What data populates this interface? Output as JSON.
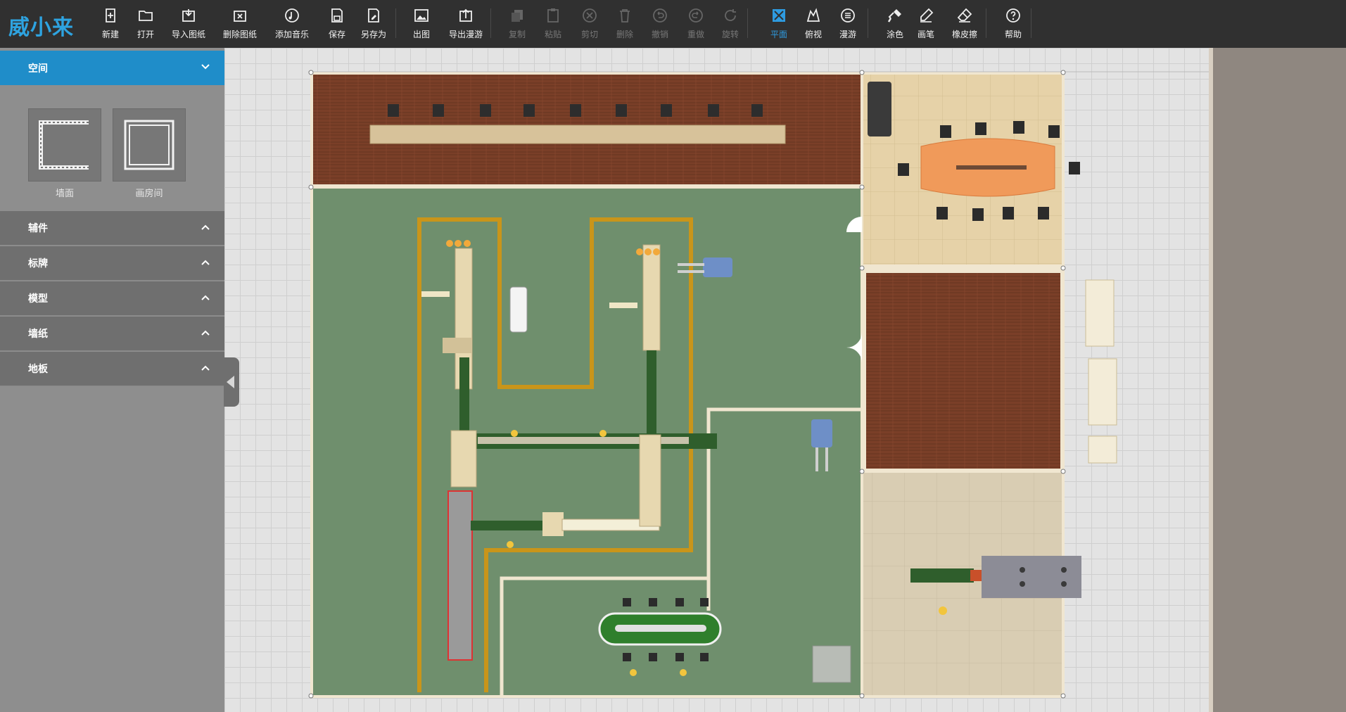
{
  "app": {
    "logo": "威小来"
  },
  "toolbar": {
    "new": "新建",
    "open": "打开",
    "import_drawing": "导入图纸",
    "delete_drawing": "删除图纸",
    "add_music": "添加音乐",
    "save": "保存",
    "save_as": "另存为",
    "render": "出图",
    "export_tour": "导出漫游",
    "copy": "复制",
    "paste": "粘贴",
    "cut": "剪切",
    "delete": "删除",
    "undo": "撤销",
    "redo": "重做",
    "rotate": "旋转",
    "plan_view": "平面",
    "top_view": "俯视",
    "roam": "漫游",
    "paint": "涂色",
    "brush": "画笔",
    "eraser": "橡皮擦",
    "help": "帮助"
  },
  "sidebar": {
    "space": {
      "title": "空间",
      "tiles": [
        {
          "label": "墙面",
          "icon": "wall-icon"
        },
        {
          "label": "画房间",
          "icon": "room-icon"
        }
      ]
    },
    "sections": [
      {
        "title": "辅件"
      },
      {
        "title": "标牌"
      },
      {
        "title": "模型"
      },
      {
        "title": "墙纸"
      },
      {
        "title": "地板"
      }
    ]
  },
  "colors": {
    "toolbar_bg": "#303030",
    "accent": "#1f8dc9",
    "factory_floor": "#6f8f6d",
    "wood_floor": "#7a3f28",
    "tile_floor": "#e6d2a8",
    "safety_line": "#c9951a"
  }
}
